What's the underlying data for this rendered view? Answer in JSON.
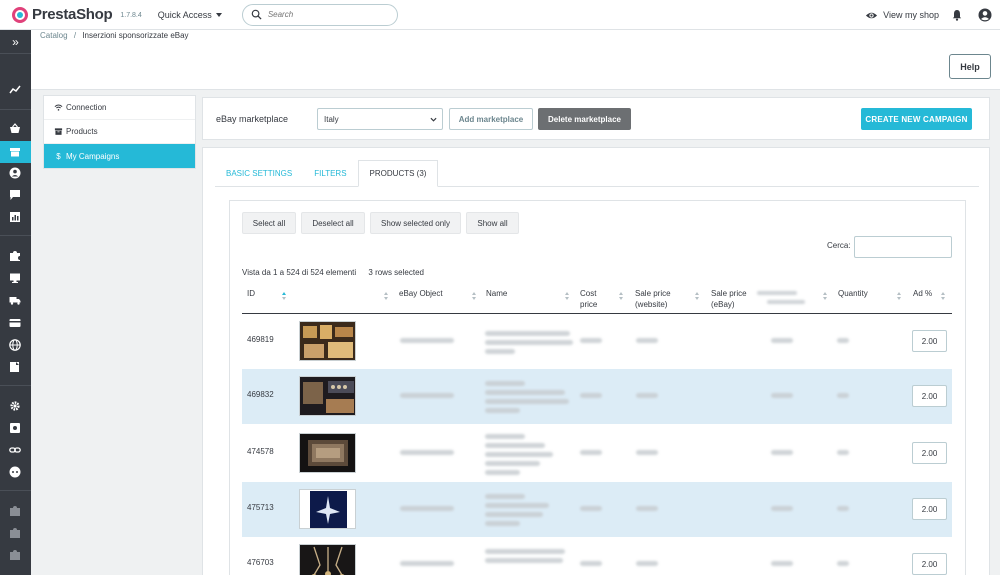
{
  "header": {
    "logo": "PrestaShop",
    "version": "1.7.8.4",
    "quick_access": "Quick Access",
    "search_placeholder": "Search",
    "view_shop": "View my shop"
  },
  "breadcrumb": {
    "parent": "Catalog",
    "separator": "/",
    "current": "Inserzioni sponsorizzate eBay"
  },
  "help_label": "Help",
  "sidebar_toggle": "»",
  "left_menu": [
    {
      "label": "Connection",
      "icon": "wifi-icon"
    },
    {
      "label": "Products",
      "icon": "archive-icon"
    },
    {
      "label": "My Campaigns",
      "icon": "dollar-icon",
      "prefix": "$"
    }
  ],
  "marketplace": {
    "label": "eBay marketplace",
    "selected": "Italy",
    "add_label": "Add marketplace",
    "delete_label": "Delete marketplace",
    "create_label": "CREATE NEW CAMPAIGN"
  },
  "tabs": [
    "BASIC SETTINGS",
    "FILTERS",
    "PRODUCTS (3)"
  ],
  "toolbar": {
    "select_all": "Select all",
    "deselect_all": "Deselect all",
    "show_selected": "Show selected only",
    "show_all": "Show all"
  },
  "search_label": "Cerca:",
  "info": {
    "range": "Vista da 1 a 524 di 524 elementi",
    "selected": "3 rows selected"
  },
  "columns": {
    "id": "ID",
    "ebay_object": "eBay Object",
    "name": "Name",
    "cost_line1": "Cost",
    "cost_line2": "price",
    "sale_web_line1": "Sale price",
    "sale_web_line2": "(website)",
    "sale_ebay_line1": "Sale price",
    "sale_ebay_line2": "(eBay)",
    "quantity": "Quantity",
    "ad": "Ad %"
  },
  "rows": [
    {
      "id": "469819",
      "ad": "2.00"
    },
    {
      "id": "469832",
      "ad": "2.00"
    },
    {
      "id": "474578",
      "ad": "2.00"
    },
    {
      "id": "475713",
      "ad": "2.00"
    },
    {
      "id": "476703",
      "ad": "2.00"
    }
  ],
  "colors": {
    "accent": "#25b9d7",
    "sidebar": "#363a41",
    "row_selected": "#dcecf6",
    "delete_button": "#6c6f72"
  }
}
